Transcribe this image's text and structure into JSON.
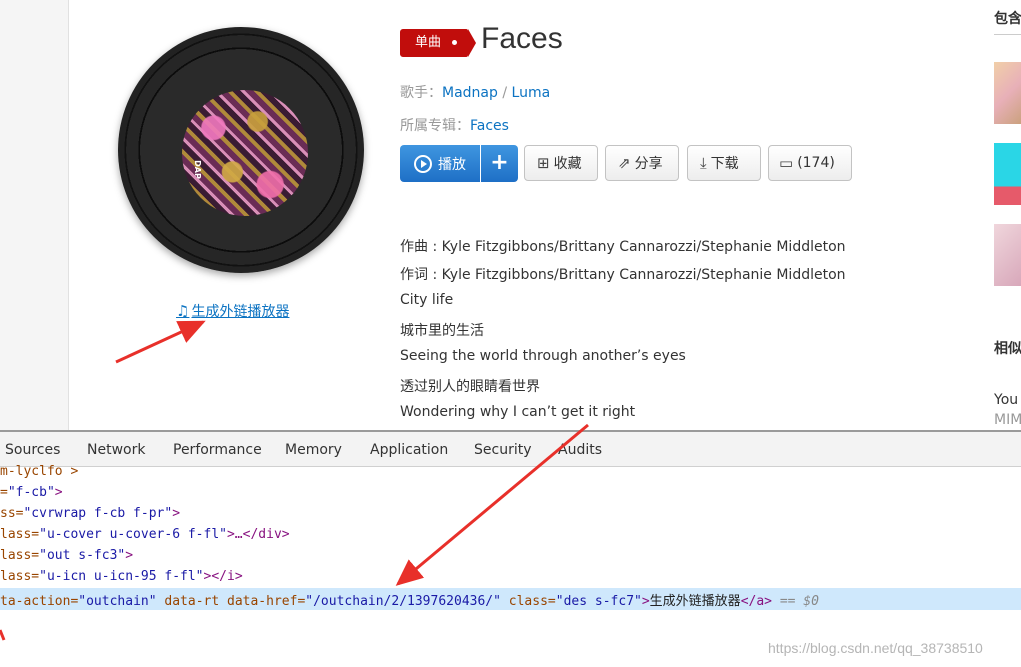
{
  "song": {
    "tag": "单曲",
    "title": "Faces",
    "artist_label": "歌手：",
    "artists": [
      "Madnap",
      "Luma"
    ],
    "album_label": "所属专辑：",
    "album": "Faces",
    "outchain_label": "生成外链播放器",
    "cover_text": "DAP"
  },
  "actions": {
    "play": "播放",
    "plus": "+",
    "collect": "收藏",
    "share": "分享",
    "download": "下载",
    "comment": "(174)"
  },
  "lyrics": [
    "作曲 : Kyle Fitzgibbons/Brittany Cannarozzi/Stephanie Middleton",
    "作词 : Kyle Fitzgibbons/Brittany Cannarozzi/Stephanie Middleton",
    "City life",
    "城市里的生活",
    "Seeing the world through another’s eyes",
    "透过别人的眼睛看世界",
    "Wondering why I can’t get it right"
  ],
  "right": {
    "heading1": "包含",
    "heading2": "相似",
    "item1": "You",
    "item2": "MIM"
  },
  "devtools": {
    "tabs": [
      "Sources",
      "Network",
      "Performance",
      "Memory",
      "Application",
      "Security",
      "Audits"
    ],
    "line0": "m-lyclfo >",
    "line1_val": "\"f-cb\"",
    "line2_attr": "ss=",
    "line2_val": "\"cvrwrap f-cb f-pr\"",
    "line3_attr": "lass=",
    "line3_val": "\"u-cover u-cover-6 f-fl\"",
    "line3_rest": ">…</div>",
    "line4_attr": "lass=",
    "line4_val": "\"out s-fc3\"",
    "line5_attr": "lass=",
    "line5_val": "\"u-icn u-icn-95 f-fl\"",
    "line5_rest": "></i>",
    "sel_attr1": "ta-action=",
    "sel_val1": "\"outchain\"",
    "sel_attr2": " data-rt data-href=",
    "sel_val2": "\"/outchain/2/1397620436/\"",
    "sel_attr3": " class=",
    "sel_val3": "\"des s-fc7\"",
    "sel_text": "生成外链播放器",
    "sel_close": "</a>",
    "sel_eq": " == $0",
    "watermark": "https://blog.csdn.net/qq_38738510"
  },
  "colors": {
    "link": "#0c73c2",
    "tag_red": "#c10d0c",
    "play_blue": "#2a7fd4",
    "arrow_red": "#e8302a"
  }
}
